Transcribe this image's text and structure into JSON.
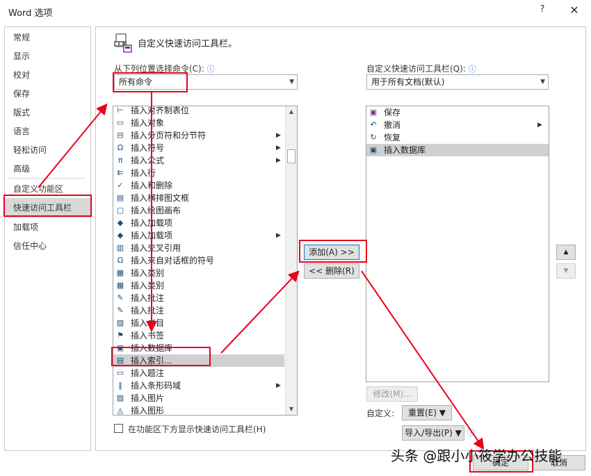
{
  "window": {
    "title": "Word 选项",
    "help_glyph": "?",
    "close_glyph": "✕"
  },
  "nav": {
    "items": [
      {
        "label": "常规"
      },
      {
        "label": "显示"
      },
      {
        "label": "校对"
      },
      {
        "label": "保存"
      },
      {
        "label": "版式"
      },
      {
        "label": "语言"
      },
      {
        "label": "轻松访问"
      },
      {
        "label": "高级"
      },
      {
        "label": "自定义功能区"
      },
      {
        "label": "快速访问工具栏",
        "selected": true
      },
      {
        "label": "加载项"
      },
      {
        "label": "信任中心"
      }
    ]
  },
  "header": {
    "title": "自定义快速访问工具栏。",
    "icon": "quick-access-toolbar-icon"
  },
  "left": {
    "choose_label": "从下列位置选择命令(C):",
    "info_glyph": "ⓘ",
    "choose_value": "所有命令",
    "dropdown_arrow": "▼",
    "commands": [
      {
        "label": "插入对齐制表位",
        "icon": "tab-stop-icon",
        "glyph": "⊢"
      },
      {
        "label": "插入对象",
        "icon": "object-icon",
        "glyph": "▭"
      },
      {
        "label": "插入分页符和分节符",
        "icon": "page-break-icon",
        "glyph": "⊟",
        "submenu": true
      },
      {
        "label": "插入符号",
        "icon": "omega-icon",
        "glyph": "Ω",
        "submenu": true
      },
      {
        "label": "插入公式",
        "icon": "pi-icon",
        "glyph": "π",
        "submenu": true
      },
      {
        "label": "插入行",
        "icon": "insert-row-icon",
        "glyph": "⇇"
      },
      {
        "label": "插入和删除",
        "icon": "checkmark-icon",
        "glyph": "✓"
      },
      {
        "label": "插入横排图文框",
        "icon": "text-frame-icon",
        "glyph": "▤"
      },
      {
        "label": "插入绘图画布",
        "icon": "drawing-canvas-icon",
        "glyph": "▢"
      },
      {
        "label": "插入加载项",
        "icon": "addin-cube-icon",
        "glyph": "◆"
      },
      {
        "label": "插入加载项",
        "icon": "addin-cube-icon",
        "glyph": "◆",
        "submenu": true
      },
      {
        "label": "插入交叉引用",
        "icon": "cross-reference-icon",
        "glyph": "▥"
      },
      {
        "label": "插入来自对话框的符号",
        "icon": "omega-icon",
        "glyph": "Ω"
      },
      {
        "label": "插入类别",
        "icon": "category-icon",
        "glyph": "▦"
      },
      {
        "label": "插入类别",
        "icon": "category-icon",
        "glyph": "▦"
      },
      {
        "label": "插入批注",
        "icon": "comment-icon",
        "glyph": "✎"
      },
      {
        "label": "插入批注",
        "icon": "comment-icon",
        "glyph": "✎"
      },
      {
        "label": "插入书目",
        "icon": "bibliography-icon",
        "glyph": "▧"
      },
      {
        "label": "插入书签",
        "icon": "bookmark-icon",
        "glyph": "⚑"
      },
      {
        "label": "插入数据库",
        "icon": "database-icon",
        "glyph": "▣"
      },
      {
        "label": "插入索引...",
        "icon": "index-icon",
        "glyph": "▤",
        "selected": true
      },
      {
        "label": "插入题注",
        "icon": "caption-icon",
        "glyph": "▭"
      },
      {
        "label": "插入条形码域",
        "icon": "barcode-icon",
        "glyph": "‖",
        "submenu": true
      },
      {
        "label": "插入图片",
        "icon": "picture-icon",
        "glyph": "▨"
      },
      {
        "label": "插入图形",
        "icon": "shapes-icon",
        "glyph": "◬"
      }
    ],
    "show_below_label": "在功能区下方显示快速访问工具栏(H)"
  },
  "middle": {
    "add_label": "添加(A) >>",
    "remove_label": "<< 删除(R)"
  },
  "right": {
    "qat_label": "自定义快速访问工具栏(Q):",
    "qat_value": "用于所有文档(默认)",
    "items": [
      {
        "label": "保存",
        "icon": "save-icon",
        "glyph": "▣"
      },
      {
        "label": "撤消",
        "icon": "undo-icon",
        "glyph": "↶",
        "submenu": true
      },
      {
        "label": "恢复",
        "icon": "redo-icon",
        "glyph": "↻"
      },
      {
        "label": "插入数据库",
        "icon": "database-icon",
        "glyph": "▣",
        "selected": true
      }
    ],
    "modify_label": "修改(M)...",
    "customize_label": "自定义:",
    "reset_label": "重置(E) ▼",
    "import_export_label": "导入/导出(P) ▼",
    "move_up_glyph": "▲",
    "move_down_glyph": "▼"
  },
  "footer": {
    "ok_label": "确定",
    "cancel_label": "取消"
  },
  "watermark": "头条 @跟小小筱学办公技能",
  "colors": {
    "annotation_red": "#e8001c",
    "selected_gray": "#d0d0d0",
    "nav_selected": "#d8d8d8"
  }
}
